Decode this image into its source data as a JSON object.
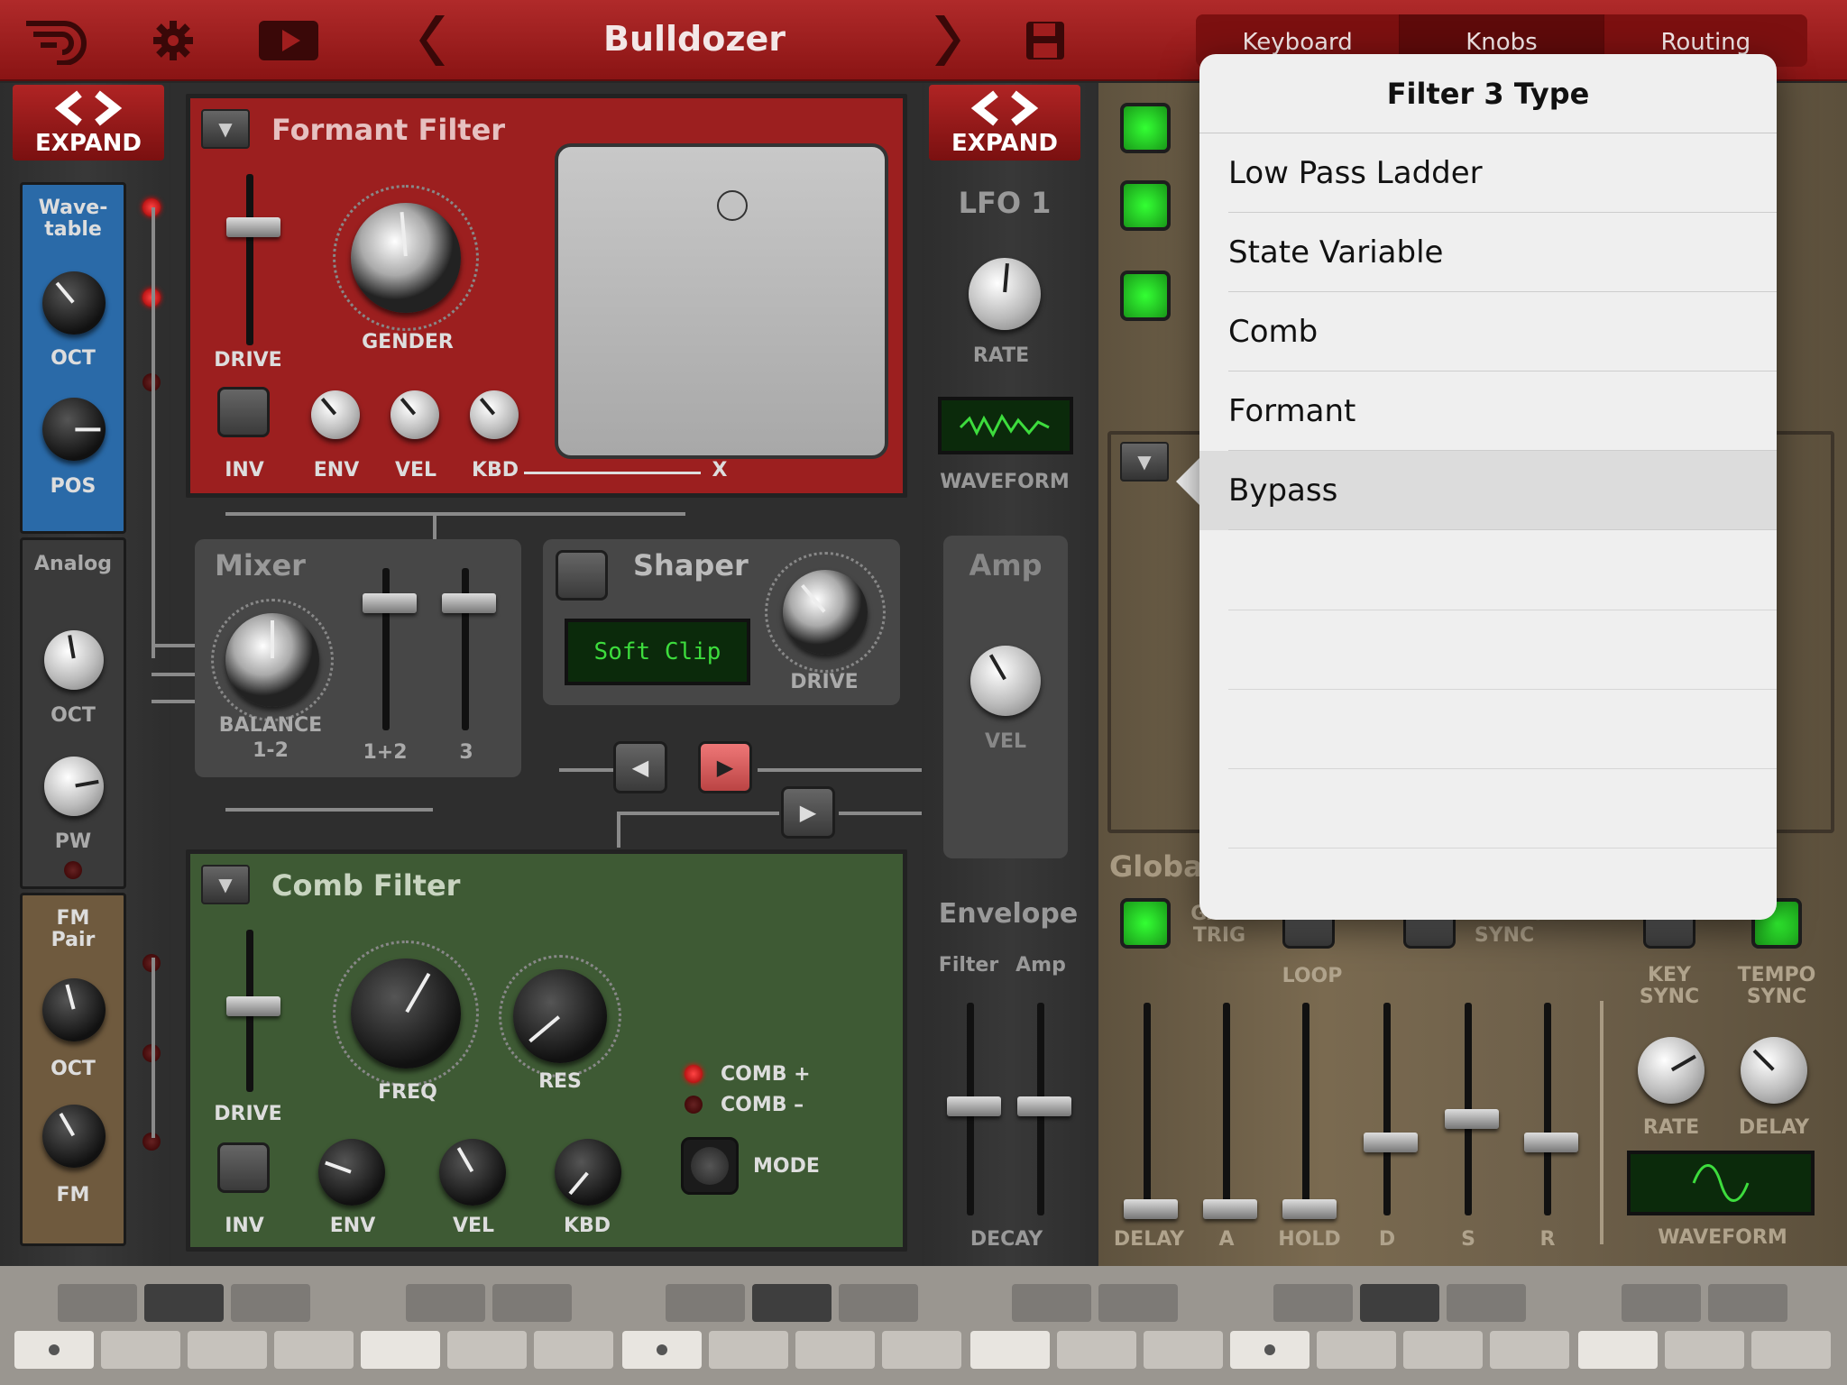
{
  "topbar": {
    "preset_name": "Bulldozer",
    "icons": [
      "logo-icon",
      "gear-icon",
      "play-icon",
      "prev-icon",
      "next-icon",
      "save-icon"
    ],
    "tabs": [
      {
        "label": "Keyboard"
      },
      {
        "label": "Knobs"
      },
      {
        "label": "Routing"
      }
    ],
    "active_tab": "Knobs"
  },
  "left_rack": {
    "expand": "EXPAND",
    "wavetable": {
      "title": "Wave-\ntable",
      "oct": "OCT",
      "pos": "POS"
    },
    "analog": {
      "title": "Analog",
      "oct": "OCT",
      "pw": "PW"
    },
    "fm": {
      "title": "FM\nPair",
      "oct": "OCT",
      "fm": "FM"
    }
  },
  "formant_filter": {
    "title": "Formant Filter",
    "drive": "DRIVE",
    "gender": "GENDER",
    "inv": "INV",
    "env": "ENV",
    "vel": "VEL",
    "kbd": "KBD",
    "x": "X"
  },
  "mixer": {
    "title": "Mixer",
    "balance": "BALANCE",
    "balance_sub": "1-2",
    "ch12": "1+2",
    "ch3": "3"
  },
  "shaper": {
    "title": "Shaper",
    "mode": "Soft Clip",
    "drive": "DRIVE"
  },
  "comb_filter": {
    "title": "Comb Filter",
    "drive": "DRIVE",
    "freq": "FREQ",
    "res": "RES",
    "comb_plus": "COMB +",
    "comb_minus": "COMB –",
    "mode": "MODE",
    "inv": "INV",
    "env": "ENV",
    "vel": "VEL",
    "kbd": "KBD"
  },
  "mod_rack": {
    "expand": "EXPAND",
    "lfo_title": "LFO 1",
    "rate": "RATE",
    "waveform": "WAVEFORM",
    "amp_title": "Amp",
    "vel": "VEL",
    "envelope_title": "Envelope",
    "filter": "Filter",
    "amp": "Amp",
    "decay": "DECAY"
  },
  "right_panel": {
    "global_title": "Global",
    "gate_trig": "GATE\nTRIG",
    "loop": "LOOP",
    "tempo_sync_left": "TEMPO\nSYNC",
    "key_sync": "KEY\nSYNC",
    "tempo_sync": "TEMPO\nSYNC",
    "env_labels": [
      "DELAY",
      "A",
      "HOLD",
      "D",
      "S",
      "R"
    ],
    "rate": "RATE",
    "delay": "DELAY",
    "waveform": "WAVEFORM"
  },
  "popover": {
    "title": "Filter 3 Type",
    "items": [
      {
        "label": "Low Pass Ladder"
      },
      {
        "label": "State Variable"
      },
      {
        "label": "Comb"
      },
      {
        "label": "Formant"
      },
      {
        "label": "Bypass"
      }
    ],
    "selected": "Bypass"
  },
  "colors": {
    "topbar": "#a01e1e",
    "formant_panel": "#9c1f1f",
    "comb_panel": "#3e5a34",
    "wavetable_panel": "#2a6aa8",
    "fm_panel": "#6f5a3e",
    "lcd_green": "#3ddc3d"
  }
}
